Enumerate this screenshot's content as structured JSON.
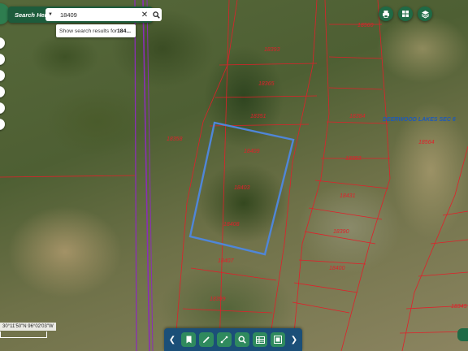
{
  "search": {
    "label": "Search Here:",
    "value": "18409",
    "clear_icon": "close-icon",
    "go_icon": "search-icon",
    "suggestion_prefix": "Show search results for ",
    "suggestion_term": "184..."
  },
  "tools": [
    {
      "name": "print-icon"
    },
    {
      "name": "grid-icon"
    },
    {
      "name": "layers-icon"
    }
  ],
  "map": {
    "subdivision_label": "DEERWOOD LAKES SEC 6",
    "parcel_labels": [
      "18409",
      "18358",
      "18365",
      "18351",
      "18393",
      "18384",
      "18383",
      "18564",
      "18403",
      "18408",
      "18407",
      "18431",
      "18390",
      "18400",
      "18399",
      "18345",
      "18560"
    ],
    "colors": {
      "parcel_line": "#e0202a",
      "selected_parcel": "#4f86d8",
      "boundary_line": "#8a2fb5"
    }
  },
  "coords": {
    "text": "30°11'50\"N 96°02'03\"W"
  },
  "bottom_bar": {
    "prev_icon": "chevron-left-icon",
    "next_icon": "chevron-right-icon",
    "buttons": [
      "bookmark-icon",
      "draw-icon",
      "measure-icon",
      "zoom-search-icon",
      "table-icon",
      "selection-icon"
    ]
  }
}
